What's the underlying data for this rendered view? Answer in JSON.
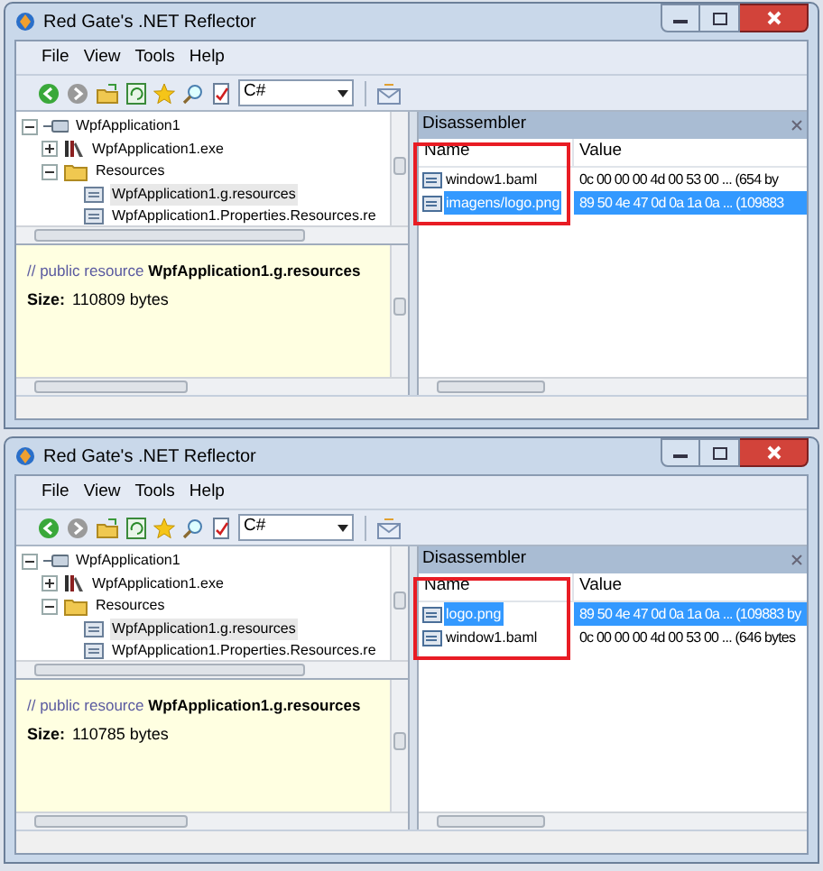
{
  "windows": [
    {
      "title": "Red Gate's .NET Reflector",
      "menu": [
        "File",
        "View",
        "Tools",
        "Help"
      ],
      "language": "C#",
      "tree": [
        {
          "label": "WpfApplication1",
          "kind": "assembly",
          "expanded": true,
          "selected": false,
          "children": [
            {
              "label": "WpfApplication1.exe",
              "kind": "module",
              "expanded": false,
              "selected": false
            },
            {
              "label": "Resources",
              "kind": "folder",
              "expanded": true,
              "selected": false,
              "children": [
                {
                  "label": "WpfApplication1.g.resources",
                  "kind": "resource",
                  "selected": true
                },
                {
                  "label": "WpfApplication1.Properties.Resources.re",
                  "kind": "resource",
                  "selected": false
                }
              ]
            }
          ]
        }
      ],
      "info": {
        "comment": "// public resource",
        "name": "WpfApplication1.g.resources",
        "size_label": "Size:",
        "size": "110809 bytes"
      },
      "panel_title": "Disassembler",
      "columns": [
        "Name",
        "Value"
      ],
      "name_column_highlighted": true,
      "rows": [
        {
          "name": "window1.baml",
          "value": "0c 00 00 00 4d 00 53 00 ... (654 by",
          "selected": false
        },
        {
          "name": "imagens/logo.png",
          "value": "89 50 4e 47 0d 0a 1a 0a ... (109883",
          "selected": true
        }
      ]
    },
    {
      "title": "Red Gate's .NET Reflector",
      "menu": [
        "File",
        "View",
        "Tools",
        "Help"
      ],
      "language": "C#",
      "tree": [
        {
          "label": "WpfApplication1",
          "kind": "assembly",
          "expanded": true,
          "selected": false,
          "children": [
            {
              "label": "WpfApplication1.exe",
              "kind": "module",
              "expanded": false,
              "selected": false
            },
            {
              "label": "Resources",
              "kind": "folder",
              "expanded": true,
              "selected": false,
              "children": [
                {
                  "label": "WpfApplication1.g.resources",
                  "kind": "resource",
                  "selected": true
                },
                {
                  "label": "WpfApplication1.Properties.Resources.re",
                  "kind": "resource",
                  "selected": false
                }
              ]
            }
          ]
        }
      ],
      "info": {
        "comment": "// public resource",
        "name": "WpfApplication1.g.resources",
        "size_label": "Size:",
        "size": "110785 bytes"
      },
      "panel_title": "Disassembler",
      "columns": [
        "Name",
        "Value"
      ],
      "name_column_highlighted": true,
      "rows": [
        {
          "name": "logo.png",
          "value": "89 50 4e 47 0d 0a 1a 0a ... (109883 by",
          "selected": true
        },
        {
          "name": "window1.baml",
          "value": "0c 00 00 00 4d 00 53 00 ... (646 bytes",
          "selected": false
        }
      ]
    }
  ]
}
